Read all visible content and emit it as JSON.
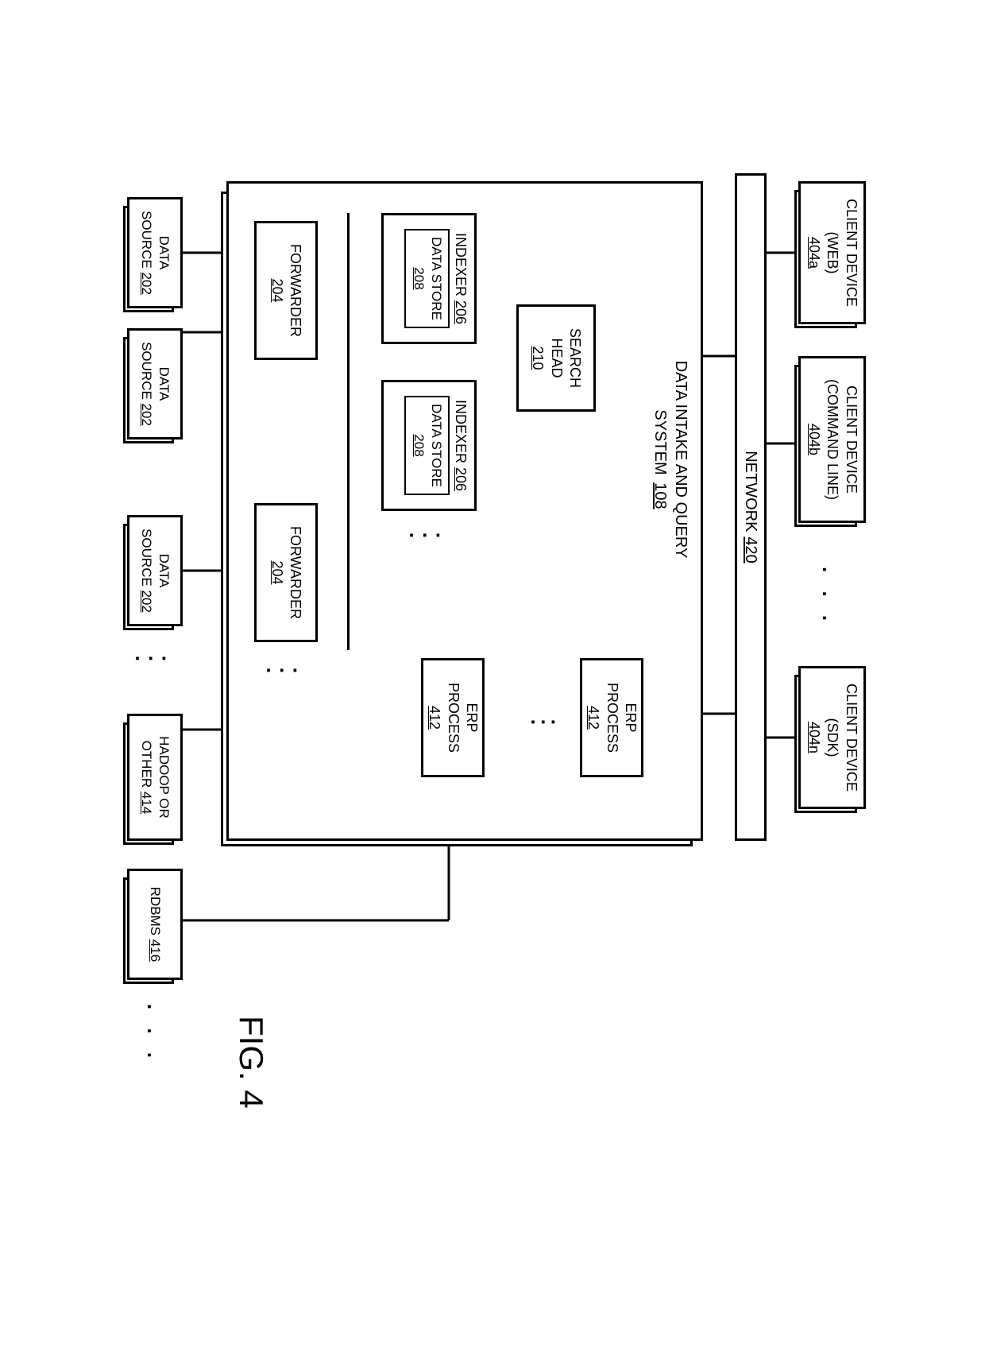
{
  "figure_label": "FIG. 4",
  "client_a": {
    "l1": "CLIENT DEVICE",
    "l2": "(WEB)",
    "ref": "404a"
  },
  "client_b": {
    "l1": "CLIENT DEVICE",
    "l2": "(COMMAND LINE)",
    "ref": "404b"
  },
  "client_n": {
    "l1": "CLIENT DEVICE",
    "l2": "(SDK)",
    "ref": "404n"
  },
  "network": {
    "label": "NETWORK",
    "ref": "420"
  },
  "system": {
    "l1": "DATA INTAKE AND QUERY",
    "l2": "SYSTEM",
    "ref": "108"
  },
  "search_head": {
    "l1": "SEARCH",
    "l2": "HEAD",
    "ref": "210"
  },
  "erp1": {
    "l1": "ERP",
    "l2": "PROCESS",
    "ref": "412"
  },
  "erp2": {
    "l1": "ERP",
    "l2": "PROCESS",
    "ref": "412"
  },
  "indexer1": {
    "l1": "INDEXER",
    "ref": "206"
  },
  "indexer2": {
    "l1": "INDEXER",
    "ref": "206"
  },
  "datastore": {
    "l1": "DATA STORE",
    "ref": "208"
  },
  "forwarder1": {
    "l1": "FORWARDER",
    "ref": "204"
  },
  "forwarder2": {
    "l1": "FORWARDER",
    "ref": "204"
  },
  "datasource": {
    "l1": "DATA",
    "l2": "SOURCE",
    "ref": "202"
  },
  "hadoop": {
    "l1": "HADOOP OR",
    "l2": "OTHER",
    "ref": "414"
  },
  "rdbms": {
    "l1": "RDBMS",
    "ref": "416"
  },
  "ellipsis": ". . ."
}
